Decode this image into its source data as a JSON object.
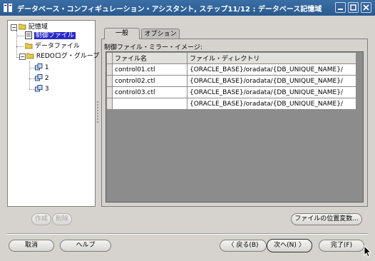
{
  "window": {
    "title": "データベース・コンフィギュレーション・アシスタント, ステップ11/12 : データベース記憶域",
    "controls": [
      "minimize-icon",
      "maximize-icon",
      "close-icon"
    ]
  },
  "tree": {
    "root": "記憶域",
    "items": [
      {
        "label": "制御ファイル",
        "selected": true,
        "icon": "control-file-icon"
      },
      {
        "label": "データファイル",
        "icon": "folder-icon"
      },
      {
        "label": "REDOログ・グループ",
        "icon": "folder-icon"
      }
    ],
    "redo_groups": [
      "1",
      "2",
      "3"
    ]
  },
  "tree_buttons": {
    "create": "作成",
    "delete": "削除"
  },
  "tabs": [
    {
      "label": "一般",
      "active": true
    },
    {
      "label": "オプション",
      "active": false
    }
  ],
  "mirror_label": "制御ファイル・ミラー・イメージ:",
  "table": {
    "headers": [
      "ファイル名",
      "ファイル・ディレクトリ"
    ],
    "rows": [
      [
        "control01.ctl",
        "{ORACLE_BASE}/oradata/{DB_UNIQUE_NAME}/"
      ],
      [
        "control02.ctl",
        "{ORACLE_BASE}/oradata/{DB_UNIQUE_NAME}/"
      ],
      [
        "control03.ctl",
        "{ORACLE_BASE}/oradata/{DB_UNIQUE_NAME}/"
      ],
      [
        "",
        "{ORACLE_BASE}/oradata/{DB_UNIQUE_NAME}/"
      ]
    ]
  },
  "file_location_button": "ファイルの位置変数...",
  "footer": {
    "cancel": "取消",
    "help": "ヘルプ",
    "back": "戻る(B)",
    "next": "次へ(N)",
    "finish": "完了(F)"
  },
  "colors": {
    "titlebar": "#2f6298",
    "selection": "#2a2ac8",
    "background": "#d6d3ce"
  }
}
